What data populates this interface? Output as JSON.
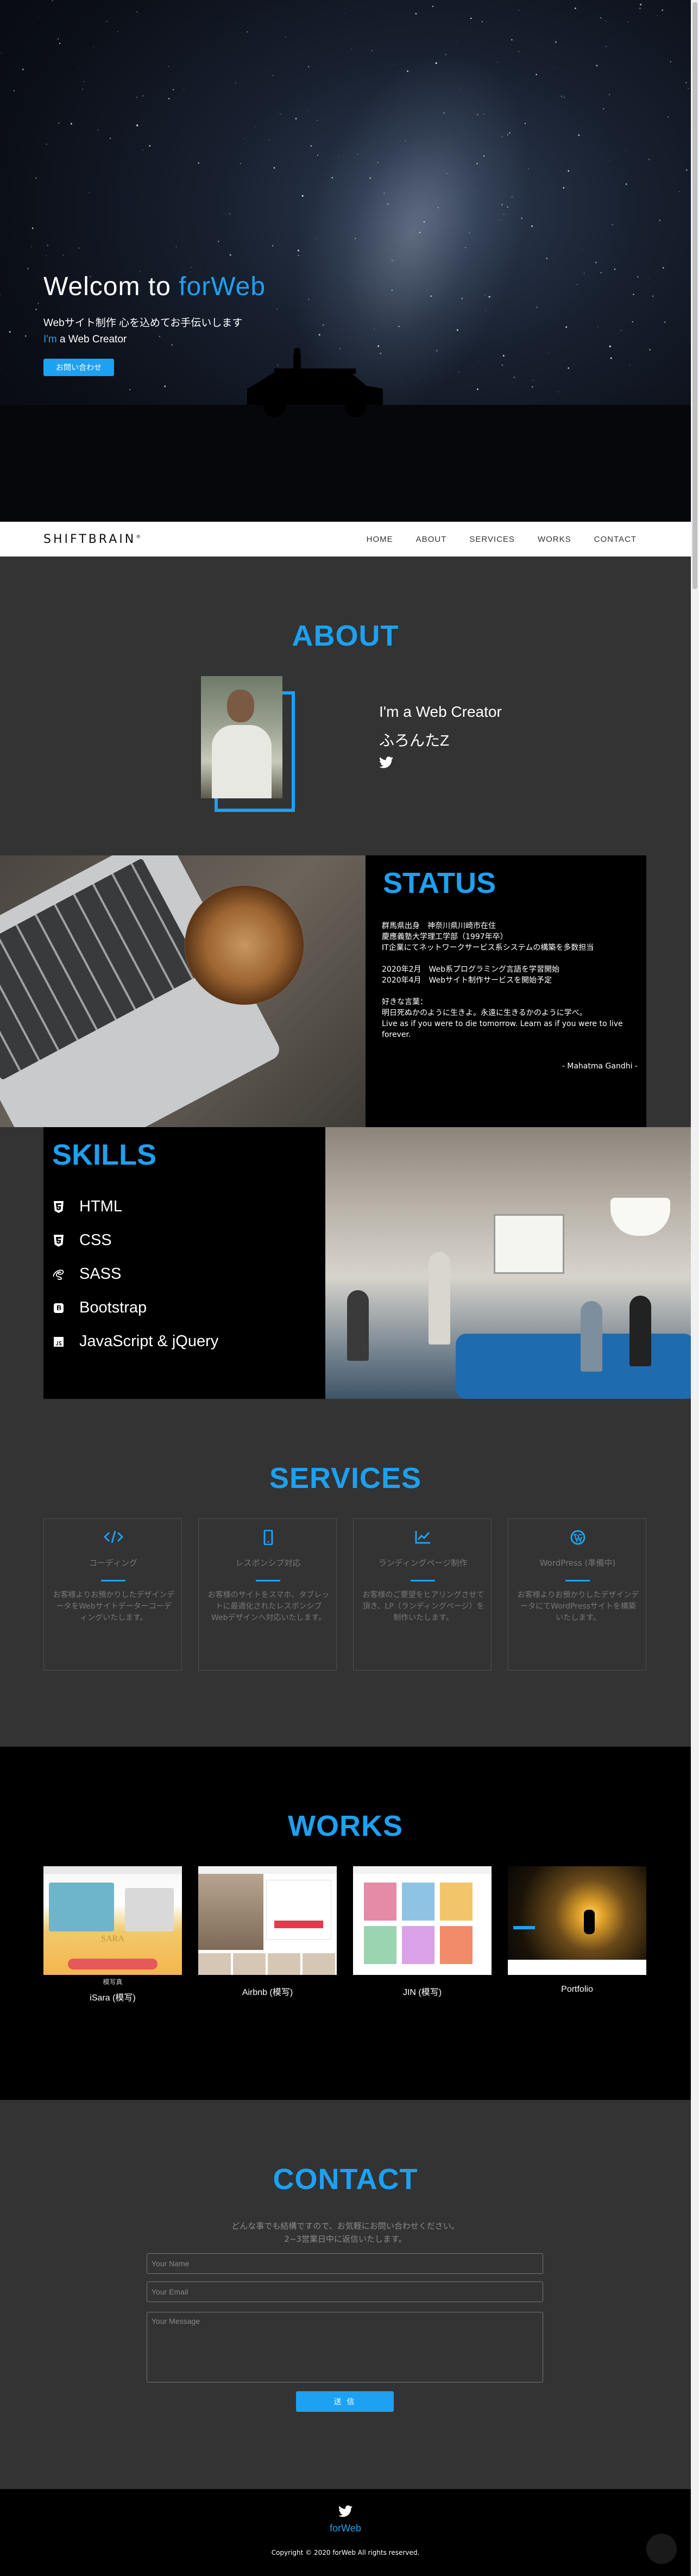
{
  "hero": {
    "title_prefix": "Welcom to ",
    "title_brand": "forWeb",
    "subtitle_line1": "Webサイト制作 心を込めてお手伝いします",
    "subtitle_im": "I'm",
    "subtitle_line2_rest": " a Web Creator",
    "cta_label": "お問い合わせ"
  },
  "nav": {
    "logo": "SHIFTBRAIN",
    "logo_mark": "®",
    "items": [
      "HOME",
      "ABOUT",
      "SERVICES",
      "WORKS",
      "CONTACT"
    ]
  },
  "about": {
    "title": "ABOUT",
    "headline": "I'm a Web Creator",
    "name": "ふろんたZ",
    "icon": "twitter-icon"
  },
  "status": {
    "title": "STATUS",
    "lines": [
      "群馬県出身　神奈川県川崎市在住",
      "慶應義塾大学理工学部（1997年卒）",
      "IT企業にてネットワークサービス系システムの構築を多数担当",
      "",
      "2020年2月　Web系プログラミング言語を学習開始",
      "2020年4月　Webサイト制作サービスを開始予定",
      "",
      "好きな言葉：",
      "明日死ぬかのように生きよ。永遠に生きるかのように学べ。",
      "Live as if you were to die tomorrow. Learn as if you were to live forever."
    ],
    "author": "- Mahatma Gandhi -"
  },
  "skills": {
    "title": "SKILLS",
    "items": [
      {
        "label": "HTML",
        "icon": "html5-icon"
      },
      {
        "label": "CSS",
        "icon": "css3-icon"
      },
      {
        "label": "SASS",
        "icon": "sass-icon"
      },
      {
        "label": "Bootstrap",
        "icon": "bootstrap-icon"
      },
      {
        "label": "JavaScript & jQuery",
        "icon": "js-icon"
      }
    ]
  },
  "services": {
    "title": "SERVICES",
    "items": [
      {
        "title": "コーディング",
        "desc": "お客様よりお預かりしたデザインデータをWebサイトデーターコーディングいたします。",
        "icon": "code-icon"
      },
      {
        "title": "レスポンシブ対応",
        "desc": "お客様のサイトをスマホ、タブレットに最適化されたレスポンシブ Webデザインへ対応いたします。",
        "icon": "mobile-icon"
      },
      {
        "title": "ランディングページ制作",
        "desc": "お客様のご要望をヒアリングさせて頂き、LP（ランディングページ）を制作いたします。",
        "icon": "chart-icon"
      },
      {
        "title": "WordPress (準備中)",
        "desc": "お客様よりお預かりしたデザインデータにてWordPressサイトを構築いたします。",
        "icon": "wordpress-icon"
      }
    ]
  },
  "works": {
    "title": "WORKS",
    "items": [
      {
        "caption": "iSara (模写)",
        "alt": "模写真",
        "thumb_text": "SARA"
      },
      {
        "caption": "Airbnb (模写)"
      },
      {
        "caption": "JIN (模写)"
      },
      {
        "caption": "Portfolio"
      }
    ]
  },
  "contact": {
    "title": "CONTACT",
    "intro_line1": "どんな事でも結構ですので、お気軽にお問い合わせください。",
    "intro_line2": "2~3営業日中に返信いたします。",
    "name_placeholder": "Your Name",
    "email_placeholder": "Your Email",
    "message_placeholder": "Your Message",
    "send_label": "送 信"
  },
  "footer": {
    "brand": "forWeb",
    "copyright": "Copyright © 2020 forWeb All rights reserved."
  },
  "colors": {
    "accent": "#1da1f2",
    "background": "#333333",
    "dark": "#000000"
  }
}
